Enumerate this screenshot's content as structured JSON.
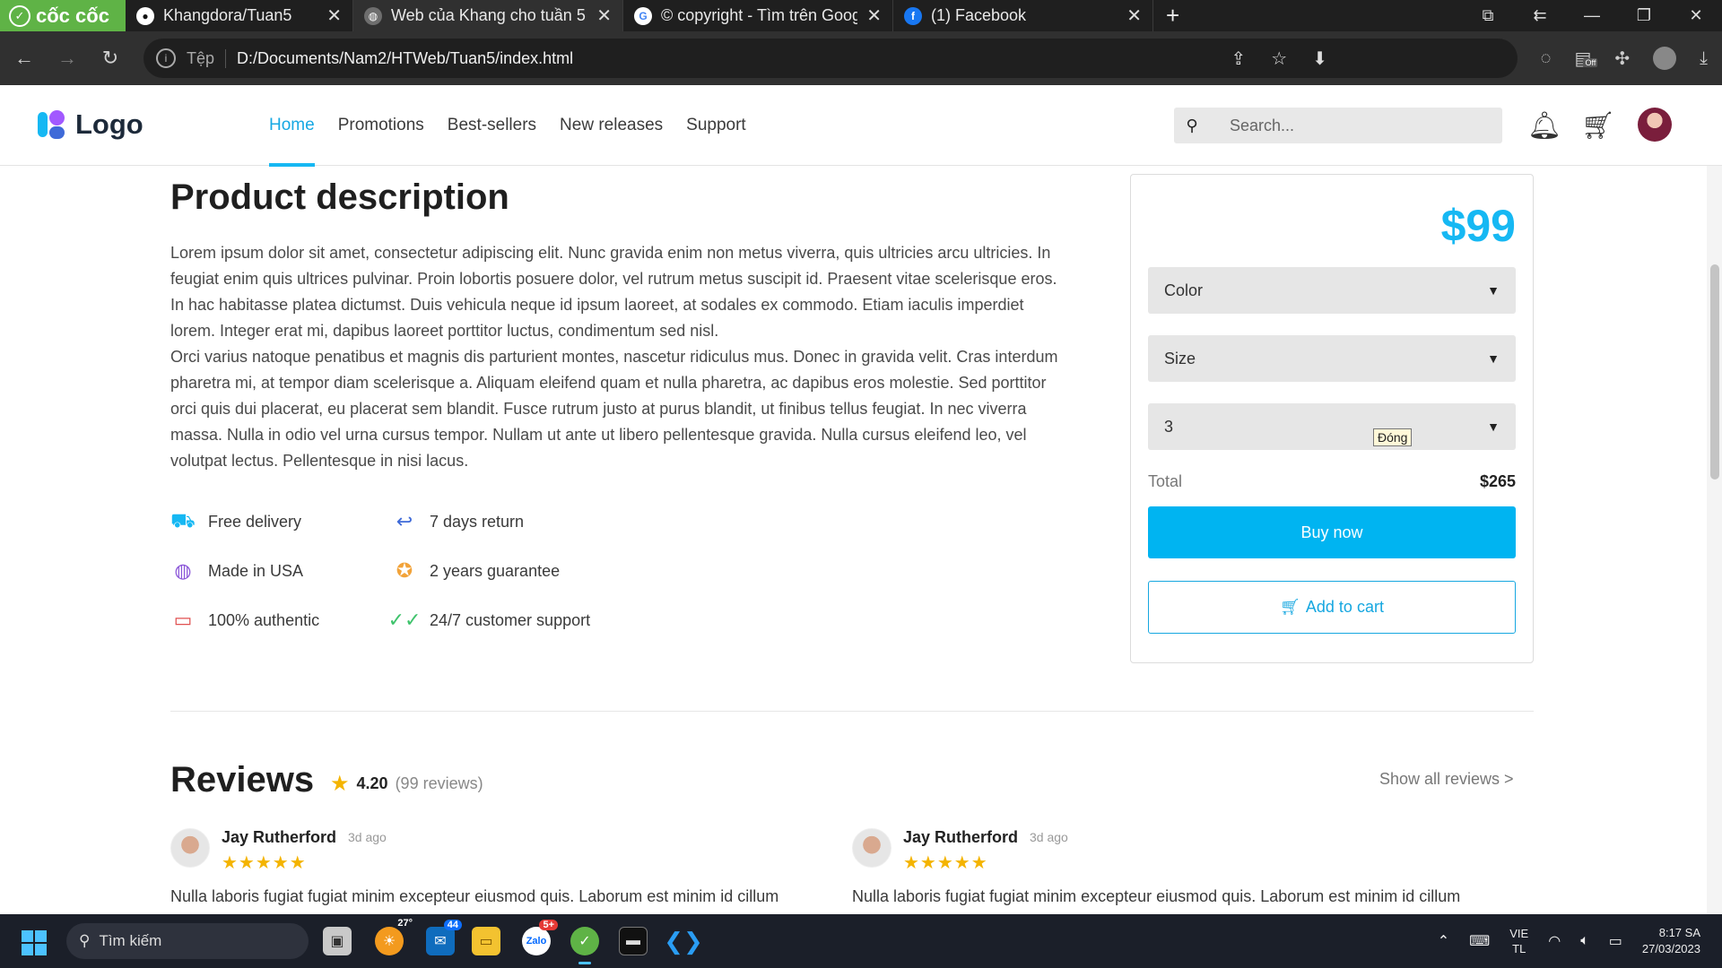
{
  "browser": {
    "brand": "cốc cốc",
    "tabs": [
      {
        "title": "Khangdora/Tuan5",
        "icon": "github-icon"
      },
      {
        "title": "Web của Khang cho tuần 5",
        "icon": "globe-icon"
      },
      {
        "title": "© copyright - Tìm trên Goog",
        "icon": "google-icon"
      },
      {
        "title": "(1) Facebook",
        "icon": "facebook-icon"
      }
    ],
    "url_label": "Tệp",
    "url": "D:/Documents/Nam2/HTWeb/Tuan5/index.html"
  },
  "header": {
    "logo_text": "Logo",
    "nav": [
      "Home",
      "Promotions",
      "Best-sellers",
      "New releases",
      "Support"
    ],
    "active_nav": "Home",
    "search_placeholder": "Search..."
  },
  "product": {
    "title": "Product description",
    "paragraphs": [
      "Lorem ipsum dolor sit amet, consectetur adipiscing elit. Nunc gravida enim non metus viverra, quis ultricies arcu ultricies. In feugiat enim quis ultrices pulvinar. Proin lobortis posuere dolor, vel rutrum metus suscipit id. Praesent vitae scelerisque eros. In hac habitasse platea dictumst. Duis vehicula neque id ipsum laoreet, at sodales ex commodo. Etiam iaculis imperdiet lorem. Integer erat mi, dapibus laoreet porttitor luctus, condimentum sed nisl.",
      "Orci varius natoque penatibus et magnis dis parturient montes, nascetur ridiculus mus. Donec in gravida velit. Cras interdum pharetra mi, at tempor diam scelerisque a. Aliquam eleifend quam et nulla pharetra, ac dapibus eros molestie. Sed porttitor orci quis dui placerat, eu placerat sem blandit. Fusce rutrum justo at purus blandit, ut finibus tellus feugiat. In nec viverra massa. Nulla in odio vel urna cursus tempor. Nullam ut ante ut libero pellentesque gravida. Nulla cursus eleifend leo, vel volutpat lectus. Pellentesque in nisi lacus."
    ],
    "features": [
      {
        "label": "Free delivery",
        "icon": "truck-icon"
      },
      {
        "label": "7 days return",
        "icon": "return-arrow-icon"
      },
      {
        "label": "Made in USA",
        "icon": "globe-icon"
      },
      {
        "label": "2 years guarantee",
        "icon": "medal-icon"
      },
      {
        "label": "100% authentic",
        "icon": "chat-icon"
      },
      {
        "label": "24/7 customer support",
        "icon": "double-check-icon"
      }
    ]
  },
  "purchase": {
    "price": "$99",
    "color_select": "Color",
    "size_select": "Size",
    "quantity_select": "3",
    "tooltip": "Đóng",
    "total_label": "Total",
    "total_value": "$265",
    "buy_label": "Buy now",
    "cart_label": "Add to cart"
  },
  "reviews": {
    "title": "Reviews",
    "rating": "4.20",
    "count": "(99 reviews)",
    "show_all": "Show all reviews >",
    "items": [
      {
        "name": "Jay Rutherford",
        "time": "3d ago",
        "stars": 5,
        "text": "Nulla laboris fugiat fugiat minim excepteur eiusmod quis. Laborum est minim id cillum"
      },
      {
        "name": "Jay Rutherford",
        "time": "3d ago",
        "stars": 5,
        "text": "Nulla laboris fugiat fugiat minim excepteur eiusmod quis. Laborum est minim id cillum"
      }
    ]
  },
  "taskbar": {
    "search_label": "Tìm kiếm",
    "weather": "27°",
    "mail_badge": "44",
    "zalo_badge": "5+",
    "lang_top": "VIE",
    "lang_bottom": "TL",
    "time": "8:17 SA",
    "date": "27/03/2023"
  },
  "colors": {
    "accent": "#16b8f3",
    "brand_green": "#5fb346",
    "star": "#f4b400"
  }
}
